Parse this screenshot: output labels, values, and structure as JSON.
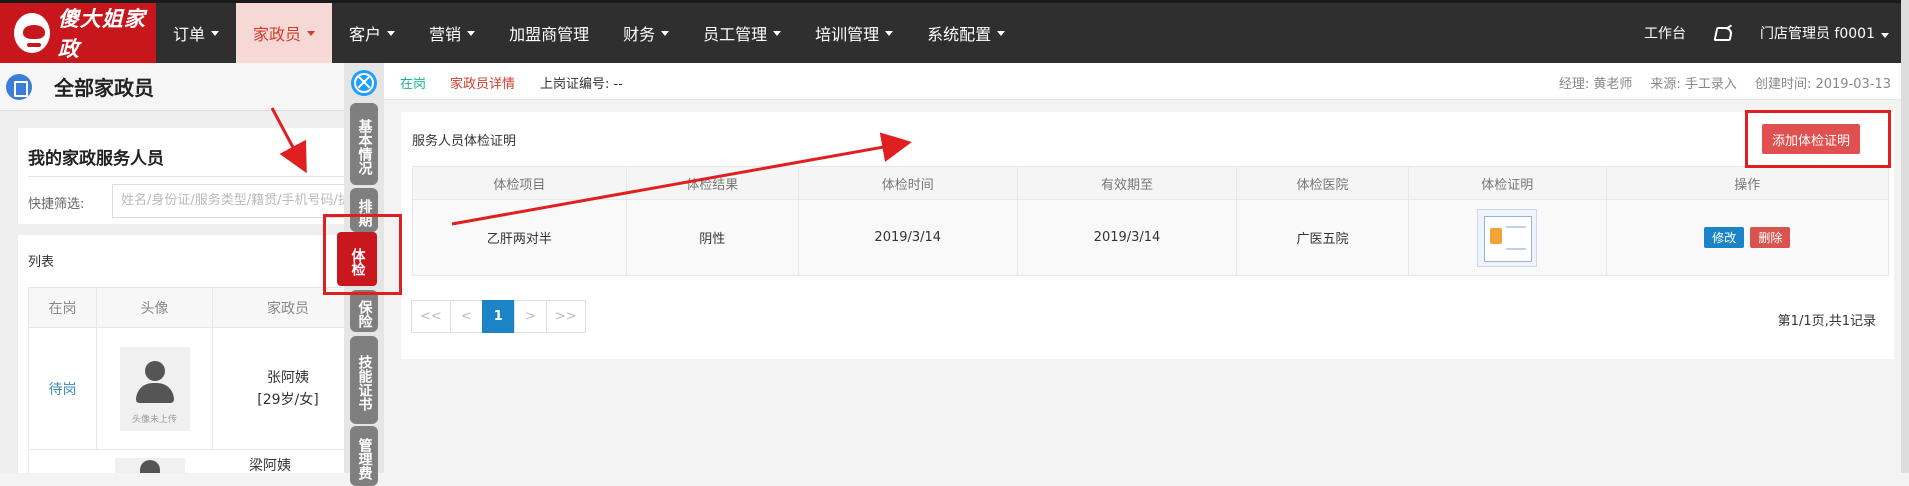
{
  "topnav": {
    "logo_text": "傻大姐家政",
    "items": [
      {
        "label": "订单",
        "has_caret": true
      },
      {
        "label": "家政员",
        "has_caret": true,
        "active": true
      },
      {
        "label": "客户",
        "has_caret": true
      },
      {
        "label": "营销",
        "has_caret": true
      },
      {
        "label": "加盟商管理",
        "has_caret": false
      },
      {
        "label": "财务",
        "has_caret": true
      },
      {
        "label": "员工管理",
        "has_caret": true
      },
      {
        "label": "培训管理",
        "has_caret": true
      },
      {
        "label": "系统配置",
        "has_caret": true
      }
    ],
    "workbench": "工作台",
    "user": "门店管理员 f0001"
  },
  "left": {
    "title": "全部家政员",
    "staff_card_title": "我的家政服务人员",
    "filter_label": "快捷筛选:",
    "search_placeholder": "姓名/身份证/服务类型/籍贯/手机号码/护",
    "list_title": "列表",
    "columns": [
      "在岗",
      "头像",
      "家政员"
    ],
    "rows": [
      {
        "status": "待岗",
        "avatar_caption": "头像未上传",
        "name": "张阿姨",
        "info": "[29岁/女]"
      },
      {
        "status": "",
        "name": "梁阿姨"
      }
    ]
  },
  "vtabs": [
    {
      "label": "基本情况"
    },
    {
      "label": "排期"
    },
    {
      "label": "体检",
      "active": true
    },
    {
      "label": "保险"
    },
    {
      "label": "技能证书"
    },
    {
      "label": "管理费"
    }
  ],
  "infobar": {
    "status": "在岗",
    "detail": "家政员详情",
    "cert_no": "上岗证编号: --",
    "manager": "经理: 黄老师",
    "source": "来源: 手工录入",
    "created": "创建时间: 2019-03-13"
  },
  "panel": {
    "title": "服务人员体检证明",
    "add_button": "添加体检证明",
    "columns": [
      "体检项目",
      "体检结果",
      "体检时间",
      "有效期至",
      "体检医院",
      "体检证明",
      "操作"
    ],
    "rows": [
      {
        "item": "乙肝两对半",
        "result": "阴性",
        "date": "2019/3/14",
        "valid_until": "2019/3/14",
        "hospital": "广医五院",
        "edit": "修改",
        "delete": "删除"
      }
    ],
    "pager": [
      "<<",
      "<",
      "1",
      ">",
      ">>"
    ],
    "page_info": "第1/1页,共1记录"
  },
  "colors": {
    "nav_bg": "#2f2f2f",
    "brand_red": "#c8161d",
    "primary_blue": "#1c84c6",
    "danger": "#e05050",
    "active_tab_red": "#c9171e",
    "annotation_red": "#e02020"
  }
}
